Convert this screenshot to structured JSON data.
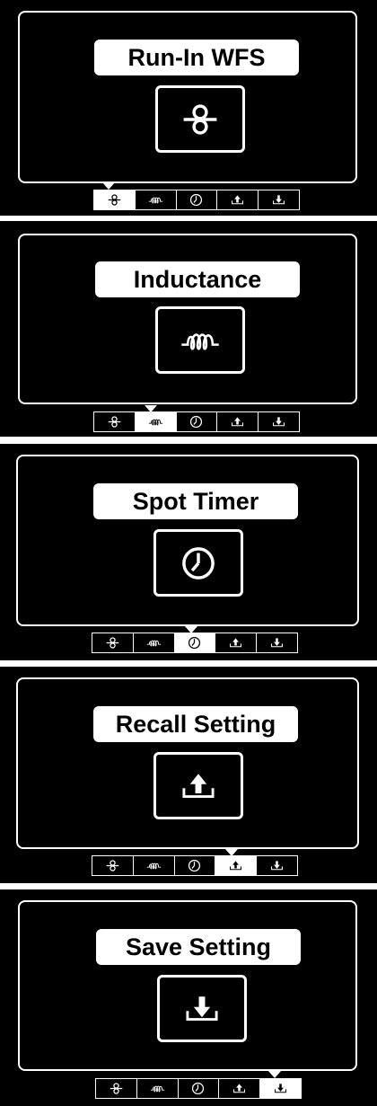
{
  "screens": [
    {
      "title": "Run-In WFS",
      "icon": "wire-feed-icon",
      "selected_tab": 0
    },
    {
      "title": "Inductance",
      "icon": "inductance-coil-icon",
      "selected_tab": 1
    },
    {
      "title": "Spot Timer",
      "icon": "clock-icon",
      "selected_tab": 2
    },
    {
      "title": "Recall Setting",
      "icon": "recall-upload-icon",
      "selected_tab": 3
    },
    {
      "title": "Save Setting",
      "icon": "save-download-icon",
      "selected_tab": 4
    }
  ],
  "tabs": [
    {
      "icon": "wire-feed-icon"
    },
    {
      "icon": "inductance-coil-icon"
    },
    {
      "icon": "clock-icon"
    },
    {
      "icon": "recall-upload-icon"
    },
    {
      "icon": "save-download-icon"
    }
  ],
  "colors": {
    "background": "#000000",
    "foreground": "#ffffff"
  }
}
